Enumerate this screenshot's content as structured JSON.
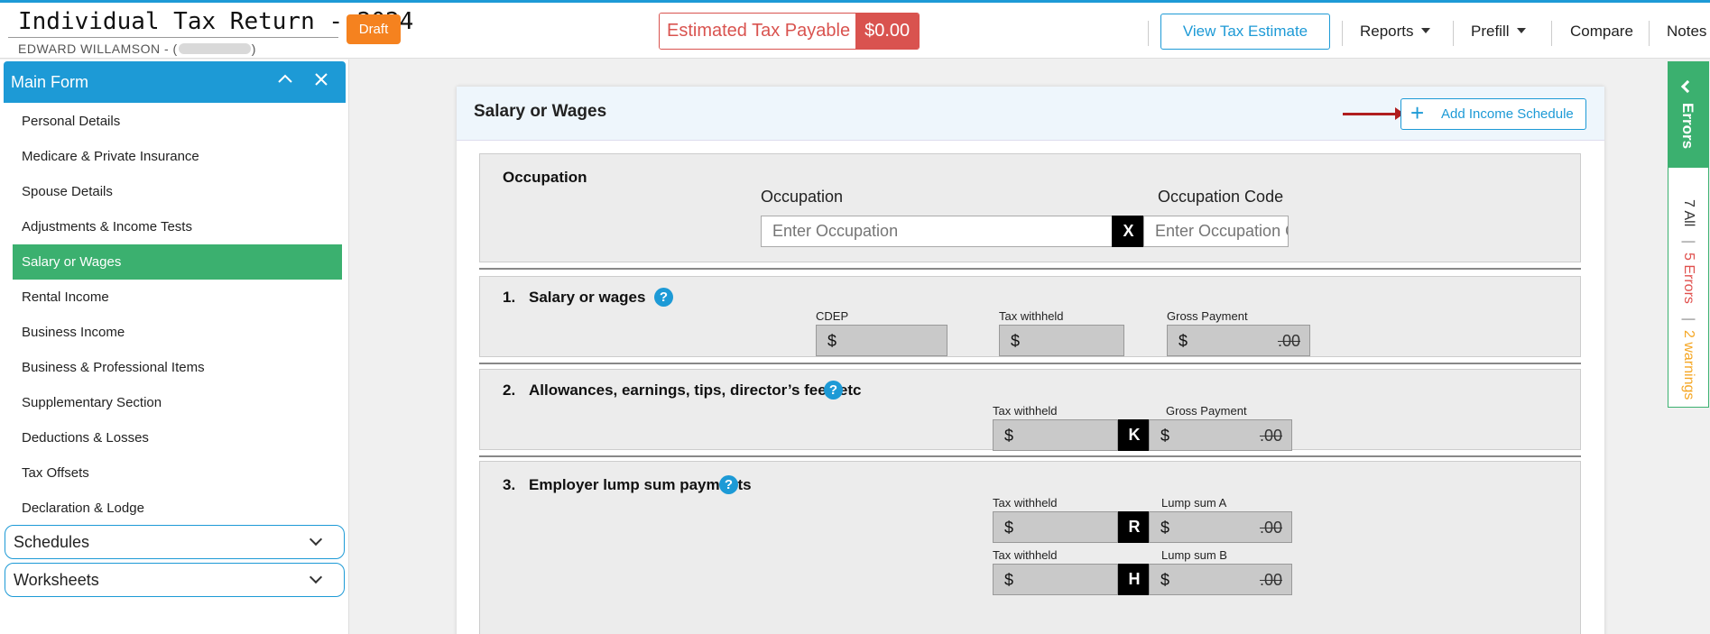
{
  "header": {
    "title": "Individual Tax Return - 2024",
    "client_name": "EDWARD WILLAMSON - (",
    "client_close": ")",
    "status_badge": "Draft",
    "tax_payable_label": "Estimated Tax Payable",
    "tax_payable_value": "$0.00",
    "view_estimate": "View Tax Estimate",
    "menus": {
      "reports": "Reports",
      "prefill": "Prefill",
      "compare": "Compare",
      "notes": "Notes"
    }
  },
  "sidebar": {
    "main_form_label": "Main Form",
    "items": [
      {
        "label": "Personal Details"
      },
      {
        "label": "Medicare & Private Insurance"
      },
      {
        "label": "Spouse Details"
      },
      {
        "label": "Adjustments & Income Tests"
      },
      {
        "label": "Salary or Wages"
      },
      {
        "label": "Rental Income"
      },
      {
        "label": "Business Income"
      },
      {
        "label": "Business & Professional Items"
      },
      {
        "label": "Supplementary Section"
      },
      {
        "label": "Deductions & Losses"
      },
      {
        "label": "Tax Offsets"
      },
      {
        "label": "Declaration & Lodge"
      }
    ],
    "active_index": 4,
    "schedules_label": "Schedules",
    "worksheets_label": "Worksheets"
  },
  "page": {
    "title": "Salary or Wages",
    "add_income_label": "Add Income Schedule",
    "occupation": {
      "section_title": "Occupation",
      "occupation_label": "Occupation",
      "occupation_placeholder": "Enter Occupation",
      "clear_label": "X",
      "code_label": "Occupation Code",
      "code_placeholder": "Enter Occupation Code"
    },
    "s1": {
      "num": "1.",
      "title": "Salary or wages",
      "cdep_label": "CDEP",
      "tax_label": "Tax withheld",
      "gross_label": "Gross Payment",
      "currency": "$",
      "cents": ".00"
    },
    "s2": {
      "num": "2.",
      "title": "Allowances, earnings, tips, director’s fees etc",
      "tax_label": "Tax withheld",
      "letter": "K",
      "gross_label": "Gross Payment",
      "currency": "$",
      "cents": ".00"
    },
    "s3": {
      "num": "3.",
      "title": "Employer lump sum payments",
      "tax_label_a": "Tax withheld",
      "letter_a": "R",
      "lump_a_label": "Lump sum A",
      "tax_label_b": "Tax withheld",
      "letter_b": "H",
      "lump_b_label": "Lump sum B",
      "currency": "$",
      "cents": ".00"
    }
  },
  "errors_panel": {
    "title": "Errors",
    "all": "7 All",
    "errors": "5 Errors",
    "warnings": "2 warnings",
    "divider": "|",
    "colors": {
      "errors": "#e0504d",
      "warnings": "#f5a623",
      "accent": "#3bb06f"
    }
  },
  "colors": {
    "primary": "#1d9ad6",
    "active": "#3bb06f",
    "danger": "#d9534f",
    "draft": "#f5821f"
  },
  "help_glyph": "?"
}
